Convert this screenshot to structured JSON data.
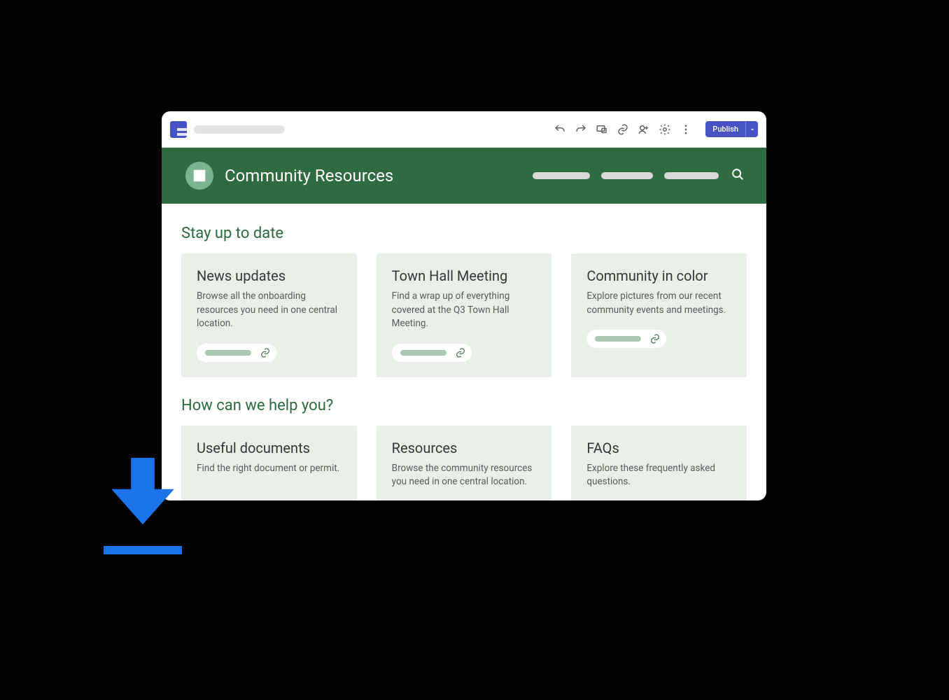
{
  "toolbar": {
    "publish_label": "Publish"
  },
  "site": {
    "title": "Community Resources"
  },
  "sections": [
    {
      "title": "Stay up to date",
      "cards": [
        {
          "title": "News updates",
          "body": "Browse all the onboarding resources you need in one central location."
        },
        {
          "title": "Town Hall Meeting",
          "body": "Find a wrap up of everything covered at the Q3 Town Hall Meeting."
        },
        {
          "title": "Community in color",
          "body": "Explore pictures from our recent community events and meetings."
        }
      ]
    },
    {
      "title": "How can we help you?",
      "cards": [
        {
          "title": "Useful documents",
          "body": "Find the right document or permit."
        },
        {
          "title": "Resources",
          "body": "Browse the community resources you need in one central location."
        },
        {
          "title": "FAQs",
          "body": "Explore these frequently asked questions."
        }
      ]
    }
  ]
}
